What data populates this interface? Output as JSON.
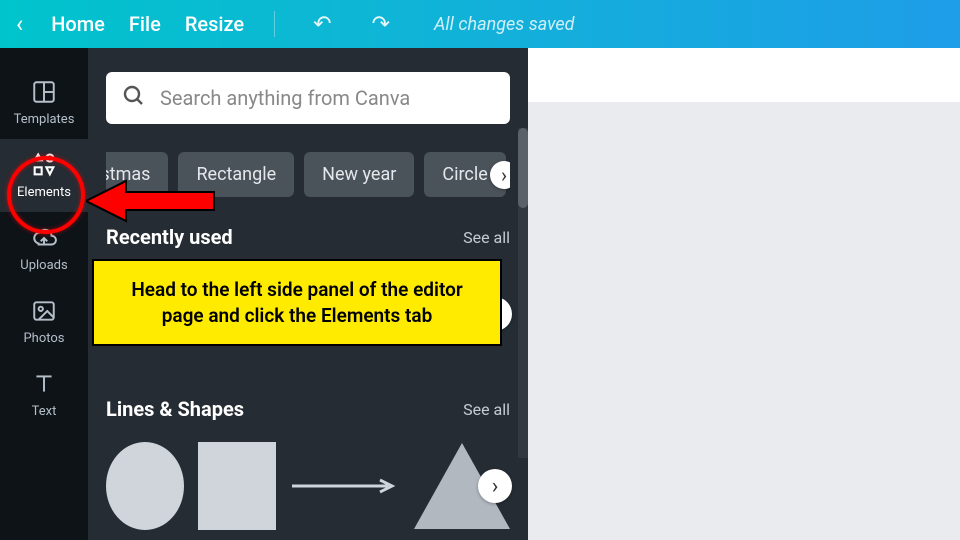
{
  "topbar": {
    "home": "Home",
    "file": "File",
    "resize": "Resize",
    "status": "All changes saved"
  },
  "sidebar": {
    "templates": "Templates",
    "elements": "Elements",
    "uploads": "Uploads",
    "photos": "Photos",
    "text": "Text"
  },
  "panel": {
    "search_placeholder": "Search anything from Canva",
    "chips": [
      "hristmas",
      "Rectangle",
      "New year",
      "Circle"
    ],
    "sections": {
      "recent": {
        "title": "Recently used",
        "see_all": "See all"
      },
      "lines": {
        "title": "Lines & Shapes",
        "see_all": "See all"
      }
    }
  },
  "callout": {
    "text": "Head to the left side panel of the editor page and click the Elements tab"
  }
}
